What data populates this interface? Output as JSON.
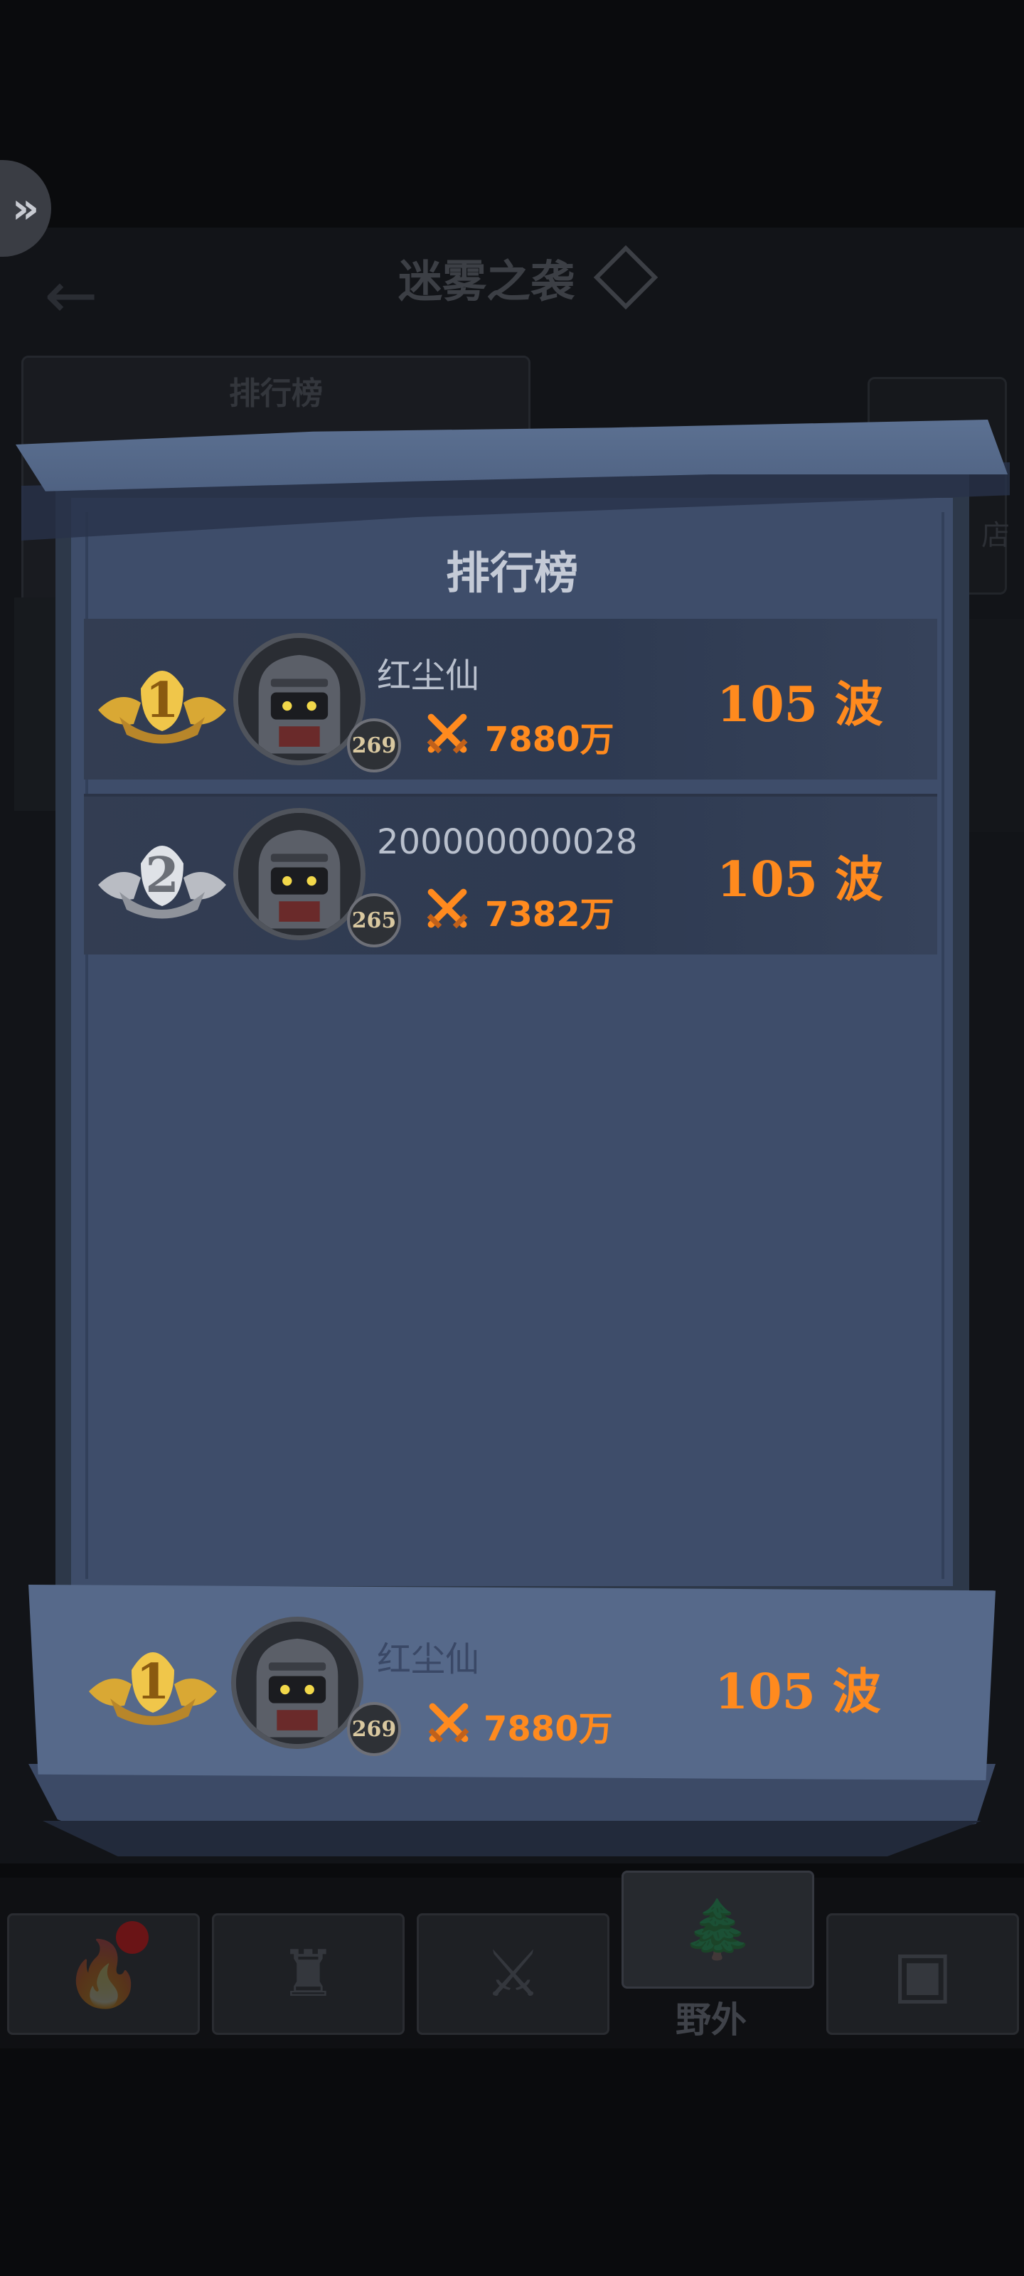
{
  "background": {
    "nav_button_glyph": "»",
    "back_glyph": "←",
    "title": "迷雾之袭",
    "rank_panel_title": "排行榜",
    "side_text": "店"
  },
  "bottom_nav": {
    "items": [
      {
        "icon": "campfire-icon",
        "glyph": "🔥",
        "has_notice": true
      },
      {
        "icon": "castle-icon",
        "glyph": "♜"
      },
      {
        "icon": "crossed-swords-icon",
        "glyph": "⚔"
      },
      {
        "icon": "forest-icon",
        "glyph": "🌲",
        "label": "野外",
        "active": true
      },
      {
        "icon": "treasure-chest-icon",
        "glyph": "▣"
      }
    ]
  },
  "leaderboard": {
    "title": "排行榜",
    "rows": [
      {
        "rank": "1",
        "medal": "gold",
        "name": "红尘仙",
        "level": "269",
        "power": "7880万",
        "wave": "105 波"
      },
      {
        "rank": "2",
        "medal": "silver",
        "name": "200000000028",
        "level": "265",
        "power": "7382万",
        "wave": "105 波"
      }
    ],
    "me": {
      "rank": "1",
      "medal": "gold",
      "name": "红尘仙",
      "level": "269",
      "power": "7880万",
      "wave": "105 波"
    }
  },
  "colors": {
    "accent_orange": "#ff8a1e",
    "gold": "#e0b43a",
    "silver": "#c9ccd2",
    "panel_blue": "#3e4d6a"
  }
}
